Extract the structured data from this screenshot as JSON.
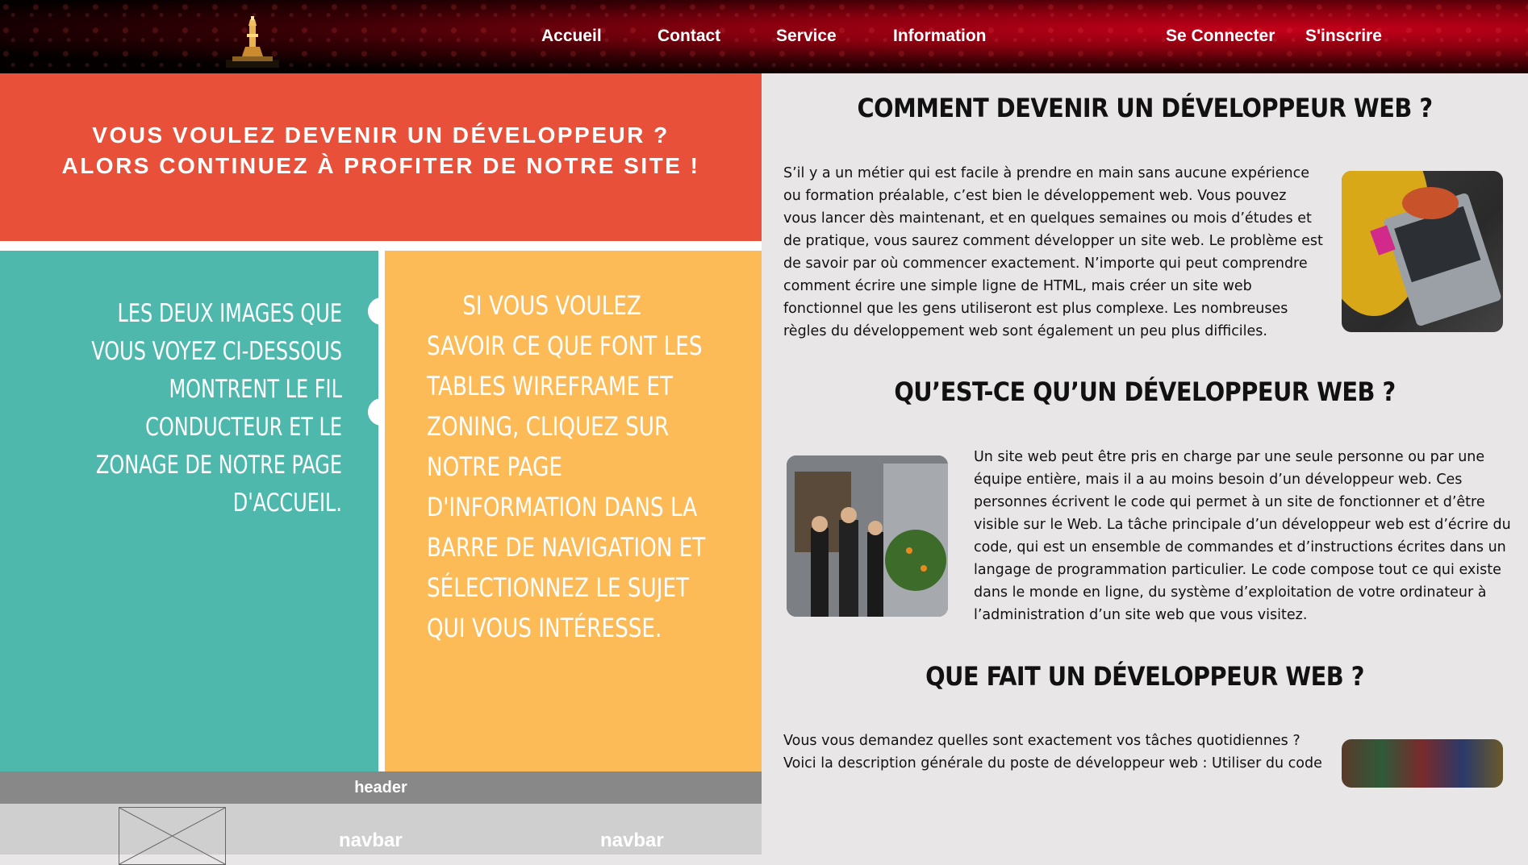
{
  "nav": {
    "links": [
      "Accueil",
      "Contact",
      "Service",
      "Information"
    ],
    "auth": [
      "Se Connecter",
      "S'inscrire"
    ]
  },
  "promo": {
    "line1": "VOUS VOULEZ DEVENIR UN DÉVELOPPEUR ?",
    "line2": "ALORS CONTINUEZ À PROFITER DE NOTRE SITE !"
  },
  "teal_text": "LES DEUX IMAGES QUE VOUS VOYEZ CI-DESSOUS MONTRENT LE FIL CONDUCTEUR ET LE ZONAGE DE NOTRE PAGE D'ACCUEIL.",
  "yellow_text": {
    "first": "SI VOUS VOULEZ",
    "rest": "SAVOIR CE QUE FONT LES TABLES WIREFRAME ET ZONING, CLIQUEZ SUR NOTRE PAGE D'INFORMATION DANS LA BARRE DE NAVIGATION ET SÉLECTIONNEZ LE SUJET QUI VOUS INTÉRESSE."
  },
  "wireframe": {
    "header": "header",
    "nav1": "navbar",
    "nav2": "navbar"
  },
  "sections": [
    {
      "title": "COMMENT DEVENIR UN DÉVELOPPEUR WEB ?",
      "text": "S’il y a un métier qui est facile à prendre en main sans aucune expérience ou formation préalable, c’est bien le développement web. Vous pouvez vous lancer dès maintenant, et en quelques semaines ou mois d’études et de pratique, vous saurez comment développer un site web. Le problème est de savoir par où commencer exactement. N’importe qui peut comprendre comment écrire une simple ligne de HTML, mais créer un site web fonctionnel que les gens utiliseront est plus complexe. Les nombreuses règles du développement web sont également un peu plus difficiles."
    },
    {
      "title": "QU’EST-CE QU’UN DÉVELOPPEUR WEB ?",
      "text": "Un site web peut être pris en charge par une seule personne ou par une équipe entière, mais il a au moins besoin d’un développeur web. Ces personnes écrivent le code qui permet à un site de fonctionner et d’être visible sur le Web. La tâche principale d’un développeur web est d’écrire du code, qui est un ensemble de commandes et d’instructions écrites dans un langage de programmation particulier. Le code compose tout ce qui existe dans le monde en ligne, du système d’exploitation de votre ordinateur à l’administration d’un site web que vous visitez."
    },
    {
      "title": "QUE FAIT UN DÉVELOPPEUR WEB ?",
      "text": "Vous vous demandez quelles sont exactement vos tâches quotidiennes ? Voici la description générale du poste de développeur web : Utiliser du code"
    }
  ]
}
